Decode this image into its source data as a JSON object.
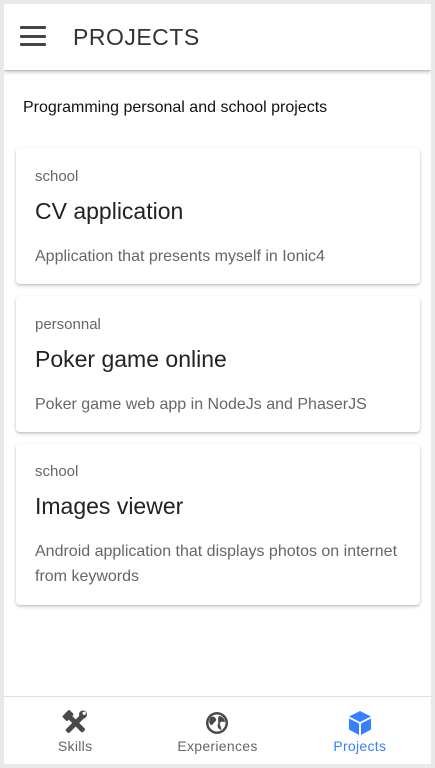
{
  "header": {
    "title": "PROJECTS",
    "menu_icon": "menu-icon"
  },
  "intro": "Programming personal and school projects",
  "cards": [
    {
      "subtitle": "school",
      "title": "CV application",
      "description": "Application that presents myself in Ionic4"
    },
    {
      "subtitle": "personnal",
      "title": "Poker game online",
      "description": "Poker game web app in NodeJs and PhaserJS"
    },
    {
      "subtitle": "school",
      "title": "Images viewer",
      "description": "Android application that displays photos on internet from keywords"
    }
  ],
  "tabs": [
    {
      "label": "Skills",
      "icon": "hammer-wrench-icon",
      "active": false
    },
    {
      "label": "Experiences",
      "icon": "globe-icon",
      "active": false
    },
    {
      "label": "Projects",
      "icon": "cube-icon",
      "active": true
    }
  ],
  "colors": {
    "accent": "#3880ff",
    "inactive": "#666666",
    "icon_inactive": "#4a4a4a"
  }
}
